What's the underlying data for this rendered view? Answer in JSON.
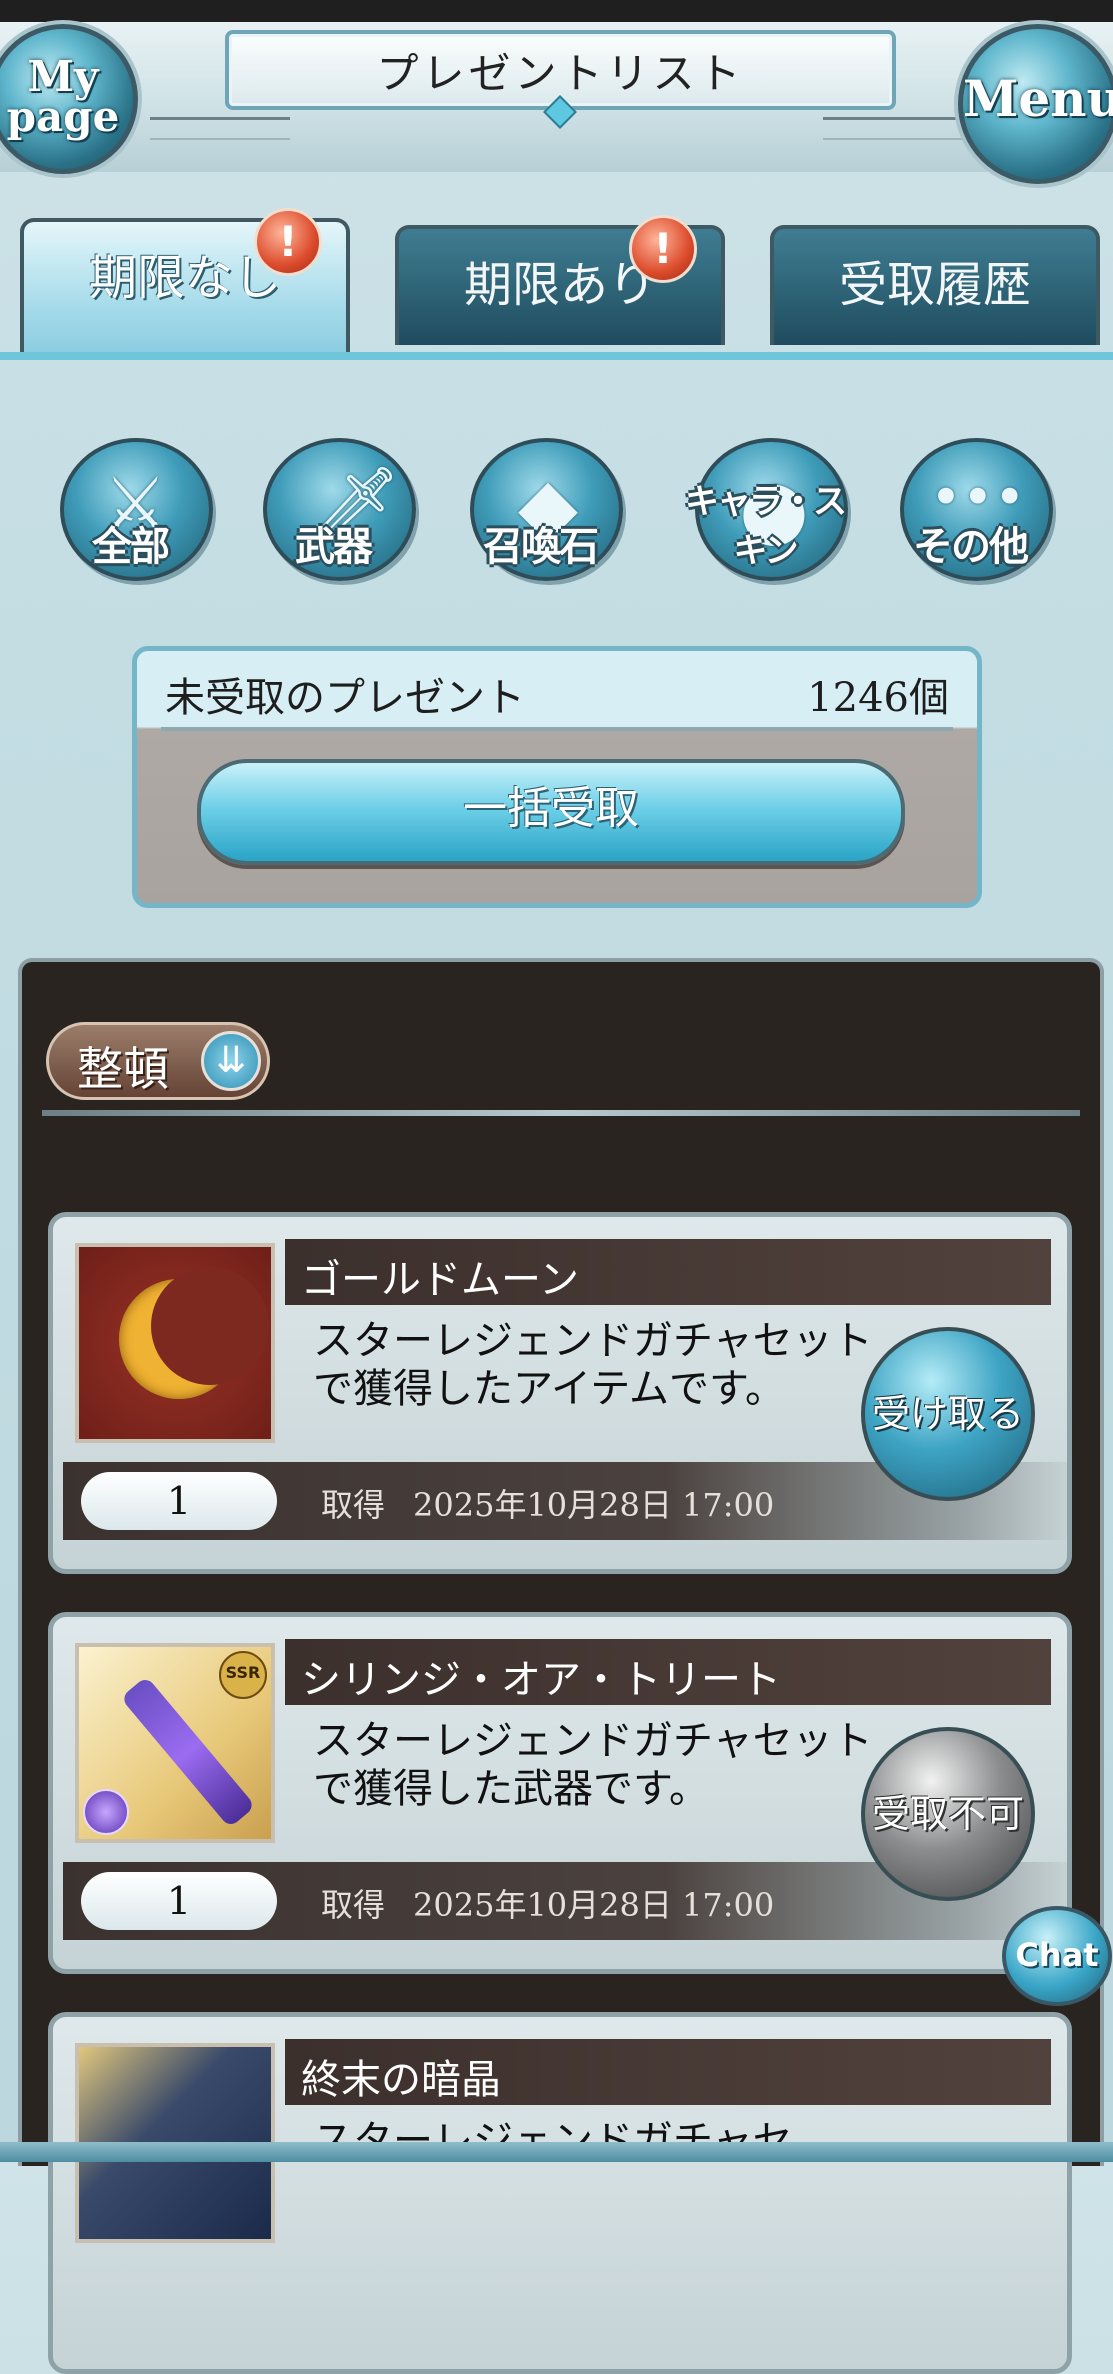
{
  "header": {
    "title": "プレゼントリスト",
    "mypage_label": "My page",
    "menu_label": "Menu"
  },
  "tabs": [
    {
      "label": "期限なし",
      "active": true,
      "has_badge": true,
      "badge": "!"
    },
    {
      "label": "期限あり",
      "active": false,
      "has_badge": true,
      "badge": "!"
    },
    {
      "label": "受取履歴",
      "active": false,
      "has_badge": false
    }
  ],
  "categories": [
    {
      "label": "全部",
      "icon": "all-icon"
    },
    {
      "label": "武器",
      "icon": "weapon-icon"
    },
    {
      "label": "召喚石",
      "icon": "summon-icon"
    },
    {
      "label": "キャラ・スキン",
      "icon": "character-icon"
    },
    {
      "label": "その他",
      "icon": "other-icon"
    }
  ],
  "unclaimed": {
    "label": "未受取のプレゼント",
    "count": "1246個",
    "bulk_button": "一括受取"
  },
  "sort": {
    "label": "整頓"
  },
  "items": [
    {
      "name": "ゴールドムーン",
      "description": "スターレジェンドガチャセットで獲得したアイテムです。",
      "quantity": "1",
      "acquired_label": "取得",
      "acquired_date": "2025年10月28日 17:00",
      "button": "受け取る",
      "claimable": true
    },
    {
      "name": "シリンジ・オア・トリート",
      "description": "スターレジェンドガチャセットで獲得した武器です。",
      "quantity": "1",
      "acquired_label": "取得",
      "acquired_date": "2025年10月28日 17:00",
      "button": "受取不可",
      "claimable": false,
      "rarity": "SSR"
    },
    {
      "name": "終末の暗晶",
      "description": "スターレジェンドガチャセ"
    }
  ],
  "chat": {
    "label": "Chat"
  },
  "colors": {
    "accent": "#5fb6cc",
    "panel": "#2a2421",
    "badge": "#dc4b2c"
  }
}
